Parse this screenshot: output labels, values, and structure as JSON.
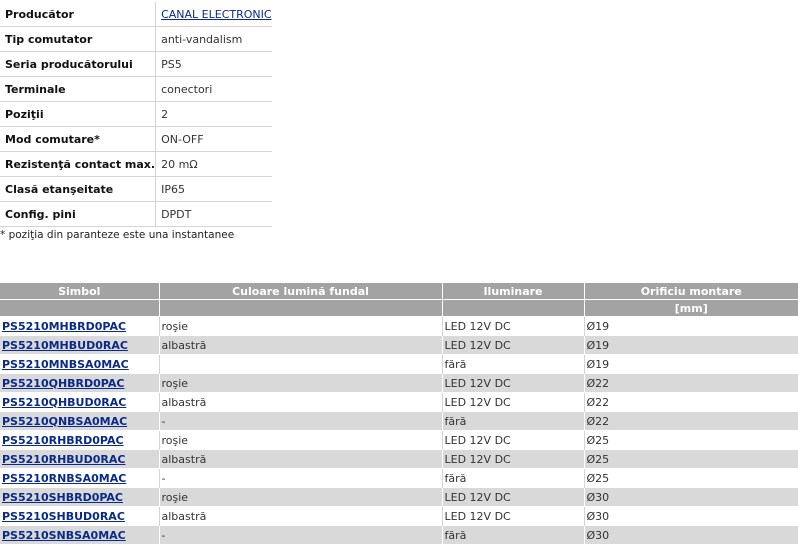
{
  "specs": [
    {
      "key": "Producător",
      "value": "CANAL ELECTRONIC",
      "link": true
    },
    {
      "key": "Tip comutator",
      "value": "anti-vandalism",
      "link": false
    },
    {
      "key": "Seria producătorului",
      "value": "PS5",
      "link": false
    },
    {
      "key": "Terminale",
      "value": "conectori",
      "link": false
    },
    {
      "key": "Poziţii",
      "value": "2",
      "link": false
    },
    {
      "key": "Mod comutare*",
      "value": "ON-OFF",
      "link": false
    },
    {
      "key": "Rezistenţă contact max.",
      "value": "20 mΩ",
      "link": false
    },
    {
      "key": "Clasă etanşeitate",
      "value": "IP65",
      "link": false
    },
    {
      "key": "Config. pini",
      "value": "DPDT",
      "link": false
    }
  ],
  "note": "* poziţia din paranteze este una instantanee",
  "table": {
    "headers": [
      "Simbol",
      "Culoare lumină fundal",
      "Iluminare",
      "Orificiu montare"
    ],
    "units": [
      "",
      "",
      "",
      "[mm]"
    ],
    "rows": [
      [
        "PS5210MHBRD0PAC",
        "roşie",
        "LED 12V DC",
        "Ø19"
      ],
      [
        "PS5210MHBUD0RAC",
        "albastră",
        "LED 12V DC",
        "Ø19"
      ],
      [
        "PS5210MNBSA0MAC",
        "",
        "fără",
        "Ø19"
      ],
      [
        "PS5210QHBRD0PAC",
        "roşie",
        "LED 12V DC",
        "Ø22"
      ],
      [
        "PS5210QHBUD0RAC",
        "albastră",
        "LED 12V DC",
        "Ø22"
      ],
      [
        "PS5210QNBSA0MAC",
        "-",
        "fără",
        "Ø22"
      ],
      [
        "PS5210RHBRD0PAC",
        "roşie",
        "LED 12V DC",
        "Ø25"
      ],
      [
        "PS5210RHBUD0RAC",
        "albastră",
        "LED 12V DC",
        "Ø25"
      ],
      [
        "PS5210RNBSA0MAC",
        "-",
        "fără",
        "Ø25"
      ],
      [
        "PS5210SHBRD0PAC",
        "roşie",
        "LED 12V DC",
        "Ø30"
      ],
      [
        "PS5210SHBUD0RAC",
        "albastră",
        "LED 12V DC",
        "Ø30"
      ],
      [
        "PS5210SNBSA0MAC",
        "-",
        "fără",
        "Ø30"
      ]
    ]
  }
}
